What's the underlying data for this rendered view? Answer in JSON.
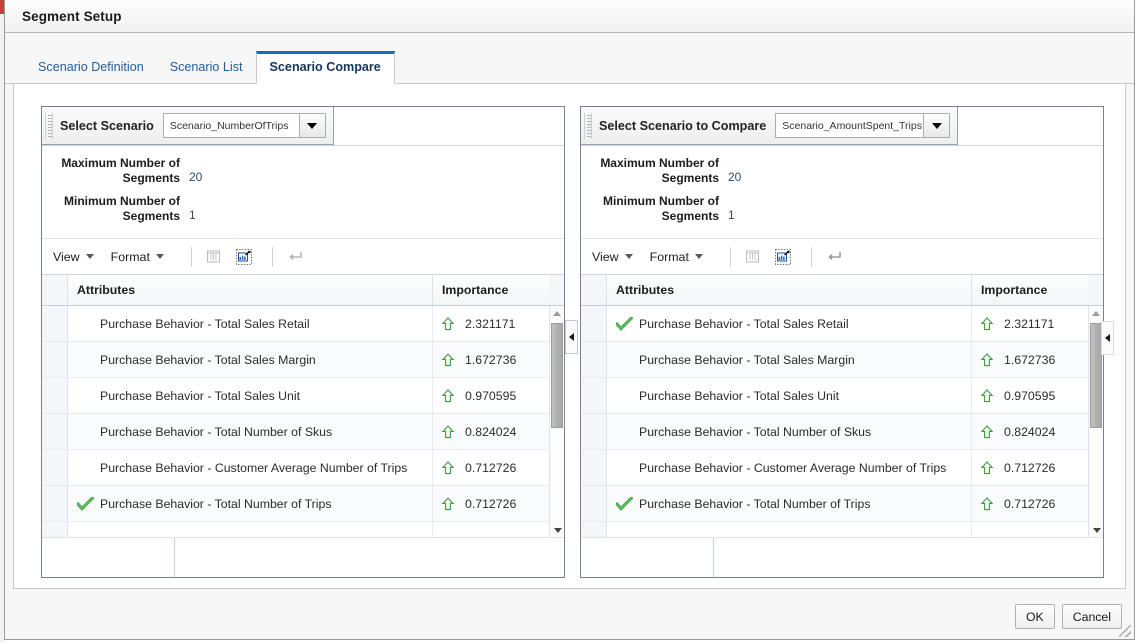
{
  "window": {
    "title": "Segment Setup"
  },
  "tabs": [
    {
      "label": "Scenario Definition",
      "active": false
    },
    {
      "label": "Scenario List",
      "active": false
    },
    {
      "label": "Scenario Compare",
      "active": true
    }
  ],
  "buttons": {
    "ok": "OK",
    "cancel": "Cancel"
  },
  "toolbar": {
    "view": "View",
    "format": "Format",
    "icons": [
      "columns-icon",
      "chart-detach-icon",
      "wrap-return-icon"
    ]
  },
  "table": {
    "columns": [
      "Attributes",
      "Importance"
    ]
  },
  "left_panel": {
    "select_label": "Select Scenario",
    "selected_scenario": "Scenario_NumberOfTrips",
    "max_segments_label": "Maximum Number of Segments",
    "max_segments_value": "20",
    "min_segments_label": "Minimum Number of Segments",
    "min_segments_value": "1",
    "rows": [
      {
        "checked": false,
        "attribute": "Purchase Behavior - Total Sales Retail",
        "trend": "up",
        "importance": "2.321171"
      },
      {
        "checked": false,
        "attribute": "Purchase Behavior - Total Sales Margin",
        "trend": "up",
        "importance": "1.672736"
      },
      {
        "checked": false,
        "attribute": "Purchase Behavior - Total Sales Unit",
        "trend": "up",
        "importance": "0.970595"
      },
      {
        "checked": false,
        "attribute": "Purchase Behavior - Total Number of Skus",
        "trend": "up",
        "importance": "0.824024"
      },
      {
        "checked": false,
        "attribute": "Purchase Behavior - Customer Average Number of Trips",
        "trend": "up",
        "importance": "0.712726"
      },
      {
        "checked": true,
        "attribute": "Purchase Behavior - Total Number of Trips",
        "trend": "up",
        "importance": "0.712726"
      }
    ]
  },
  "right_panel": {
    "select_label": "Select Scenario to Compare",
    "selected_scenario": "Scenario_AmountSpent_Trips",
    "max_segments_label": "Maximum Number of Segments",
    "max_segments_value": "20",
    "min_segments_label": "Minimum Number of Segments",
    "min_segments_value": "1",
    "rows": [
      {
        "checked": true,
        "attribute": "Purchase Behavior - Total Sales Retail",
        "trend": "up",
        "importance": "2.321171"
      },
      {
        "checked": false,
        "attribute": "Purchase Behavior - Total Sales Margin",
        "trend": "up",
        "importance": "1.672736"
      },
      {
        "checked": false,
        "attribute": "Purchase Behavior - Total Sales Unit",
        "trend": "up",
        "importance": "0.970595"
      },
      {
        "checked": false,
        "attribute": "Purchase Behavior - Total Number of Skus",
        "trend": "up",
        "importance": "0.824024"
      },
      {
        "checked": false,
        "attribute": "Purchase Behavior - Customer Average Number of Trips",
        "trend": "up",
        "importance": "0.712726"
      },
      {
        "checked": true,
        "attribute": "Purchase Behavior - Total Number of Trips",
        "trend": "up",
        "importance": "0.712726"
      }
    ]
  },
  "colors": {
    "accent": "#0572ce",
    "tab_link": "#245c9c",
    "check_green": "#3ea33e",
    "arrow_green": "#3e9b3e",
    "value_blue": "#2e4c66"
  }
}
